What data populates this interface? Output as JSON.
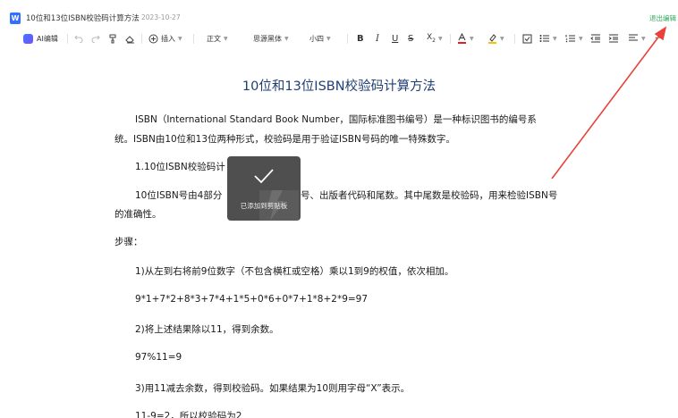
{
  "titlebar": {
    "doc_icon": "W",
    "doc_title": "10位和13位ISBN校验码计算方法",
    "date": "2023-10-27",
    "exit_edit": "退出编辑"
  },
  "toolbar": {
    "ai_label": "AI编辑",
    "insert_label": "插入",
    "style_label": "正文",
    "font_label": "思源黑体",
    "size_label": "小四",
    "more_label": "···",
    "icons": [
      "undo-icon",
      "redo-icon",
      "format-painter-icon",
      "eraser-icon",
      "insert-icon",
      "bold-icon",
      "italic-icon",
      "underline-icon",
      "strikethrough-icon",
      "subscript-icon",
      "font-color-icon",
      "highlight-icon",
      "checkbox-icon",
      "bullet-list-icon",
      "numbered-list-icon",
      "indent-decrease-icon",
      "indent-increase-icon",
      "align-icon"
    ],
    "font_color": "#e02020",
    "highlight_color": "#f5c400"
  },
  "document": {
    "heading": "10位和13位ISBN校验码计算方法",
    "paragraphs": [
      "ISBN（International Standard Book Number，国际标准图书编号）是一种标识图书的编号系",
      "统。ISBN由10位和13位两种形式，校验码是用于验证ISBN号码的唯一特殊数字。",
      "1.10位ISBN校验码计",
      "10位ISBN号由4部分",
      "号、出版者代码和尾数。其中尾数是校验码，用来检验ISBN号",
      "的准确性。",
      "步骤：",
      "1)从左到右将前9位数字（不包含横杠或空格）乘以1到9的权值，依次相加。",
      "9*1+7*2+8*3+7*4+1*5+0*6+0*7+1*8+2*9=97",
      "2)将上述结果除以11，得到余数。",
      "97%11=9",
      "3)用11减去余数，得到校验码。如果结果为10则用字母“X”表示。",
      "11-9=2，所以校验码为2"
    ]
  },
  "toast": {
    "message": "已添加到剪贴板",
    "icon": "check-icon"
  },
  "annotation": {
    "color": "#e8423a"
  }
}
